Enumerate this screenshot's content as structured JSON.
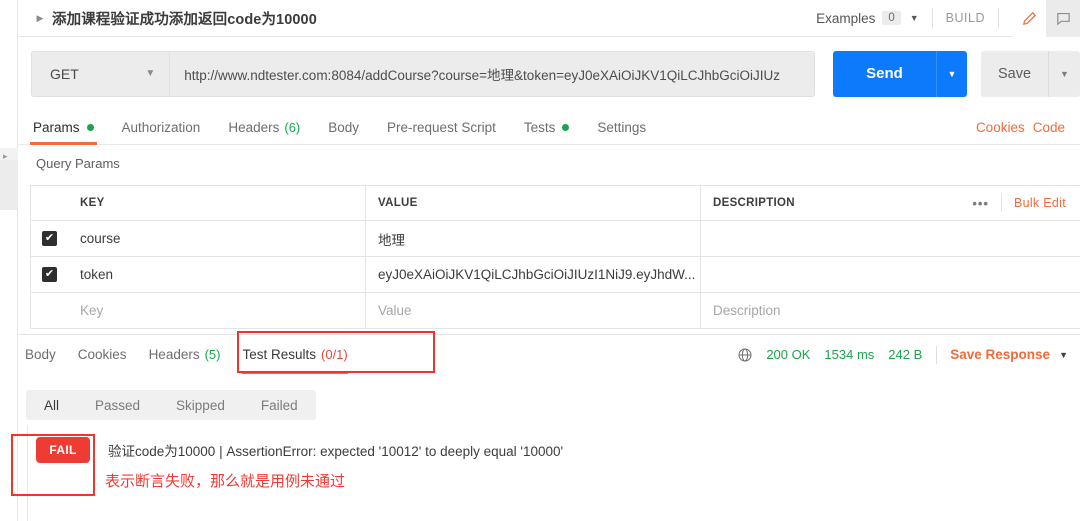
{
  "request": {
    "title": "添加课程验证成功添加返回code为10000",
    "collapse_icon": "triangle-right-icon",
    "examples_label": "Examples",
    "examples_count": "0",
    "build_label": "BUILD",
    "pencil_icon": "pencil-edit-icon",
    "comment_icon": "comment-icon",
    "method": "GET",
    "url": "http://www.ndtester.com:8084/addCourse?course=地理&token=eyJ0eXAiOiJKV1QiLCJhbGciOiJIUz",
    "send_label": "Send",
    "save_label": "Save"
  },
  "request_tabs": {
    "items": [
      {
        "label": "Params",
        "active": true,
        "dot": true,
        "count": ""
      },
      {
        "label": "Authorization",
        "active": false,
        "dot": false,
        "count": ""
      },
      {
        "label": "Headers",
        "active": false,
        "dot": false,
        "count": "(6)"
      },
      {
        "label": "Body",
        "active": false,
        "dot": false,
        "count": ""
      },
      {
        "label": "Pre-request Script",
        "active": false,
        "dot": false,
        "count": ""
      },
      {
        "label": "Tests",
        "active": false,
        "dot": true,
        "count": ""
      },
      {
        "label": "Settings",
        "active": false,
        "dot": false,
        "count": ""
      }
    ],
    "cookies_label": "Cookies",
    "code_label": "Code"
  },
  "query_params": {
    "section_label": "Query Params",
    "columns": [
      "KEY",
      "VALUE",
      "DESCRIPTION"
    ],
    "more_icon": "ellipsis-icon",
    "bulk_edit_label": "Bulk Edit",
    "rows": [
      {
        "checked": true,
        "key": "course",
        "value": "地理",
        "description": ""
      },
      {
        "checked": true,
        "key": "token",
        "value": "eyJ0eXAiOiJKV1QiLCJhbGciOiJIUzI1NiJ9.eyJhdW...",
        "description": ""
      }
    ],
    "placeholder_row": {
      "key": "Key",
      "value": "Value",
      "description": "Description"
    }
  },
  "response": {
    "tabs": [
      {
        "label": "Body",
        "active": false,
        "count": ""
      },
      {
        "label": "Cookies",
        "active": false,
        "count": ""
      },
      {
        "label": "Headers",
        "active": false,
        "count": "(5)"
      },
      {
        "label": "Test Results",
        "active": true,
        "count": "(0/1)"
      }
    ],
    "globe_icon": "globe-icon",
    "status": "200 OK",
    "time": "1534 ms",
    "size": "242 B",
    "save_response_label": "Save Response",
    "filters": [
      {
        "label": "All",
        "active": true
      },
      {
        "label": "Passed",
        "active": false
      },
      {
        "label": "Skipped",
        "active": false
      },
      {
        "label": "Failed",
        "active": false
      }
    ],
    "results": [
      {
        "badge": "FAIL",
        "text": "验证code为10000 | AssertionError: expected '10012' to deeply equal '10000'"
      }
    ]
  },
  "annotations": {
    "note": "表示断言失败，那么就是用例未通过",
    "highlight_color": "#f4332a"
  }
}
